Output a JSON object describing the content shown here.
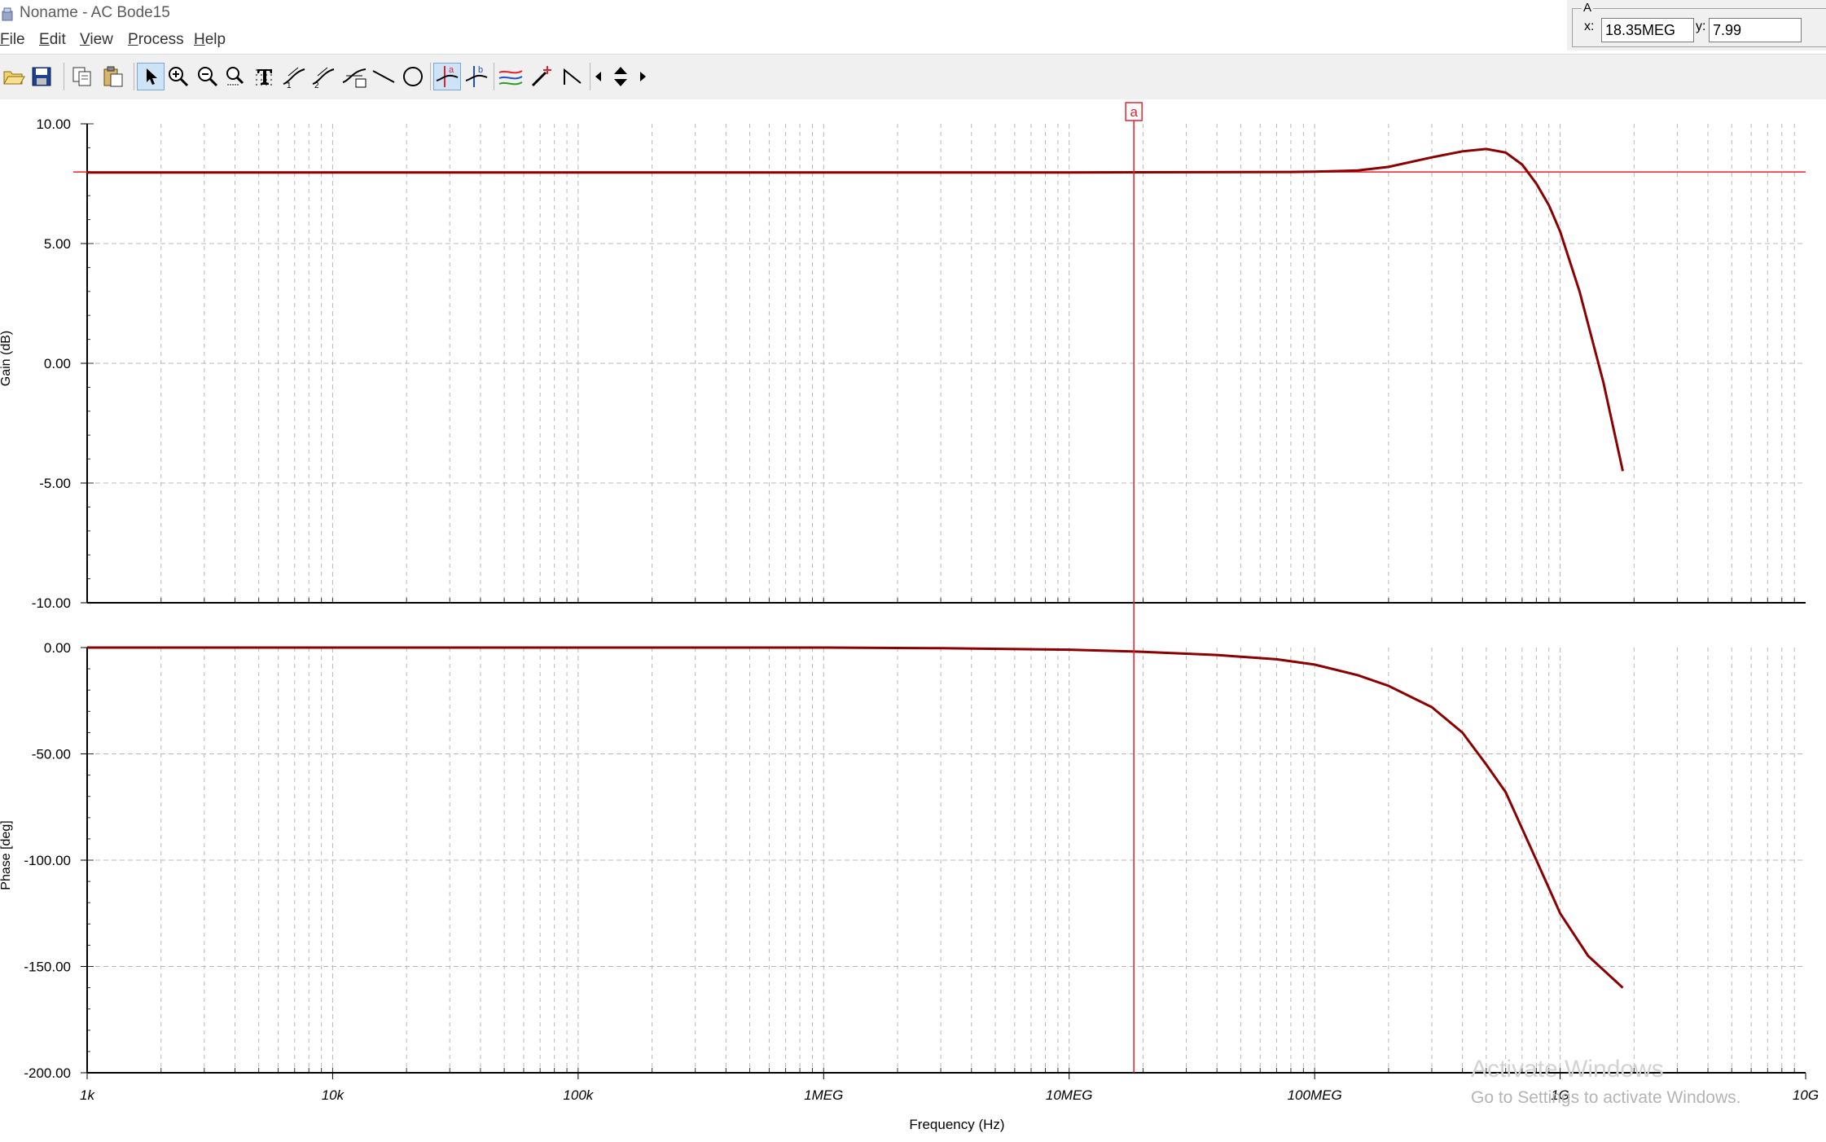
{
  "window": {
    "title": "Noname - AC Bode15"
  },
  "menu": [
    "File",
    "Edit",
    "View",
    "Process",
    "Help"
  ],
  "toolbar": {
    "buttons": [
      {
        "icon": "open-folder-icon"
      },
      {
        "icon": "save-disk-icon"
      },
      {
        "icon": "copy-icon"
      },
      {
        "icon": "paste-icon"
      },
      {
        "icon": "pointer-arrow-icon",
        "active": true
      },
      {
        "icon": "zoom-in-icon"
      },
      {
        "icon": "zoom-out-icon"
      },
      {
        "icon": "zoom-100-icon"
      },
      {
        "icon": "grid-dots-icon"
      },
      {
        "icon": "text-tool-icon"
      },
      {
        "icon": "curve-label-icon"
      },
      {
        "icon": "curve-label-2-icon"
      },
      {
        "icon": "curve-marker-icon"
      },
      {
        "icon": "line-tool-icon"
      },
      {
        "icon": "circle-tool-icon"
      },
      {
        "icon": "cursor-a-icon",
        "active": true
      },
      {
        "icon": "cursor-b-icon"
      },
      {
        "icon": "multiple-curves-icon"
      },
      {
        "icon": "add-marker-icon"
      },
      {
        "icon": "slope-icon"
      },
      {
        "icon": "move-left-icon"
      },
      {
        "icon": "move-updown-icon"
      },
      {
        "icon": "move-right-icon"
      }
    ]
  },
  "cursor_readout": {
    "panel_title": "A",
    "x_label": "x:",
    "x_value": "18.35MEG",
    "y_label": "y:",
    "y_value": "7.99"
  },
  "watermark": {
    "line1": "Activate Windows",
    "line2": "Go to Settings to activate Windows."
  },
  "colors": {
    "trace": "#8b0000",
    "cursor": "#e8212b",
    "grid": "#b8b8b8",
    "toolbar_active": "#cfe3f7"
  },
  "chart_data": [
    {
      "type": "line",
      "ylabel": "Gain (dB)",
      "xscale": "log",
      "xlim": [
        1000,
        10000000000
      ],
      "ylim": [
        -10,
        10
      ],
      "yticks": [
        "10.00",
        "5.00",
        "0.00",
        "-5.00",
        "-10.00"
      ],
      "grid": true,
      "cursor": {
        "label": "a",
        "x": 18350000,
        "y": 7.99
      },
      "series": [
        {
          "x": [
            1000,
            10000,
            100000,
            1000000,
            10000000,
            80000000,
            100000000,
            150000000,
            200000000,
            300000000,
            400000000,
            500000000,
            600000000,
            700000000,
            800000000,
            900000000,
            1000000000,
            1200000000,
            1500000000,
            1800000000
          ],
          "y": [
            7.97,
            7.97,
            7.97,
            7.97,
            7.97,
            7.99,
            8.0,
            8.05,
            8.2,
            8.6,
            8.85,
            8.95,
            8.8,
            8.3,
            7.5,
            6.6,
            5.5,
            3.0,
            -0.8,
            -4.5
          ]
        }
      ]
    },
    {
      "type": "line",
      "xlabel": "Frequency (Hz)",
      "ylabel": "Phase [deg]",
      "xscale": "log",
      "xlim": [
        1000,
        10000000000
      ],
      "ylim": [
        -200,
        0
      ],
      "yticks": [
        "0.00",
        "-50.00",
        "-100.00",
        "-150.00",
        "-200.00"
      ],
      "xticks": [
        "1k",
        "10k",
        "100k",
        "1MEG",
        "10MEG",
        "100MEG",
        "1G",
        "10G"
      ],
      "grid": true,
      "cursor": {
        "label": "a",
        "x": 18350000
      },
      "series": [
        {
          "x": [
            1000,
            10000,
            100000,
            1000000,
            3000000,
            10000000,
            20000000,
            40000000,
            70000000,
            100000000,
            150000000,
            200000000,
            300000000,
            400000000,
            500000000,
            600000000,
            800000000,
            1000000000,
            1300000000,
            1800000000
          ],
          "y": [
            0,
            0,
            0,
            0,
            -0.3,
            -1,
            -2,
            -3.5,
            -5.5,
            -8,
            -13,
            -18,
            -28,
            -40,
            -55,
            -68,
            -100,
            -125,
            -145,
            -160
          ]
        }
      ]
    }
  ]
}
